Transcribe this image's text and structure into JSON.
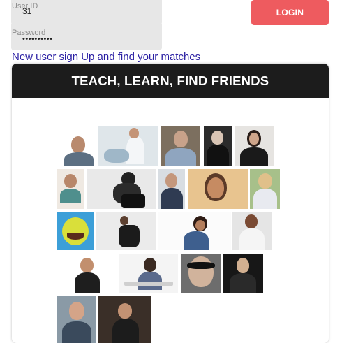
{
  "login_form": {
    "user_id_label": "User ID",
    "user_id_value": "31",
    "password_label": "Password",
    "password_value": "••••••••••",
    "login_button": "LOGIN"
  },
  "signup_link": "New user sign Up and find your matches",
  "card": {
    "title": "TEACH, LEARN, FIND FRIENDS"
  },
  "colors": {
    "login_button": "#ee5b5f",
    "card_header": "#1c1c1c",
    "link": "#2a1fa3"
  }
}
